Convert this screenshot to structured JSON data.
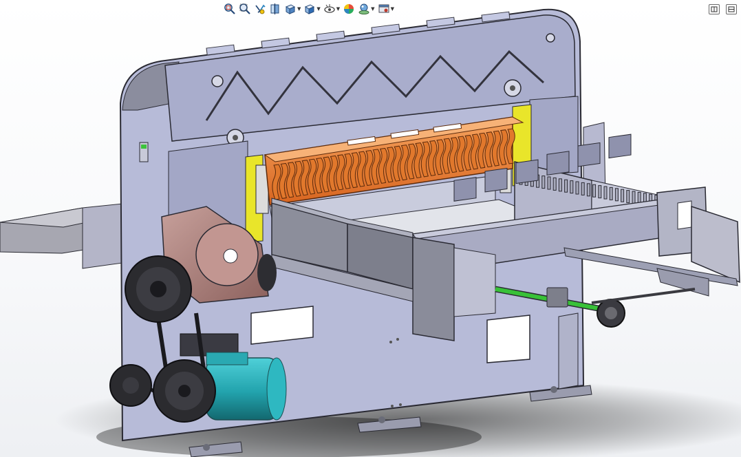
{
  "app": {
    "kind": "cad-3d-viewport",
    "background": "#ffffff"
  },
  "hud_toolbar": {
    "buttons": [
      {
        "name": "zoom-to-fit",
        "icon": "zoom-to-fit-icon",
        "dropdown": false
      },
      {
        "name": "zoom-to-area",
        "icon": "zoom-to-area-icon",
        "dropdown": false
      },
      {
        "name": "previous-view",
        "icon": "previous-view-icon",
        "dropdown": false
      },
      {
        "name": "section-view",
        "icon": "section-view-icon",
        "dropdown": false
      },
      {
        "name": "view-orientation",
        "icon": "view-orientation-icon",
        "dropdown": true
      },
      {
        "name": "display-style",
        "icon": "display-style-icon",
        "dropdown": true
      },
      {
        "name": "hide-show-items",
        "icon": "hide-show-items-icon",
        "dropdown": true
      },
      {
        "name": "edit-appearance",
        "icon": "edit-appearance-icon",
        "dropdown": false
      },
      {
        "name": "apply-scene",
        "icon": "apply-scene-icon",
        "dropdown": true
      },
      {
        "name": "view-settings",
        "icon": "view-settings-icon",
        "dropdown": true
      }
    ]
  },
  "window_controls": [
    {
      "name": "restore",
      "icon": "window-restore-icon"
    },
    {
      "name": "split",
      "icon": "window-split-icon"
    }
  ],
  "model": {
    "subject": "paper-cutting-machine-assembly",
    "colors": {
      "frame": "#bcc0dc",
      "frame_dark": "#7f7f8f",
      "frame_edge": "#2a2a33",
      "blade": "#f08a3a",
      "blade_dark": "#b8561a",
      "rail": "#e7e427",
      "motor": "#24a9b3",
      "motor_dark": "#17737a",
      "gearbox": "#b98a86",
      "gearbox_dark": "#7e5854",
      "pulley": "#2b2b2e",
      "shaft": "#35c235",
      "table": "#9c9ca6",
      "floor_shadow": "#2a2a2a"
    }
  }
}
